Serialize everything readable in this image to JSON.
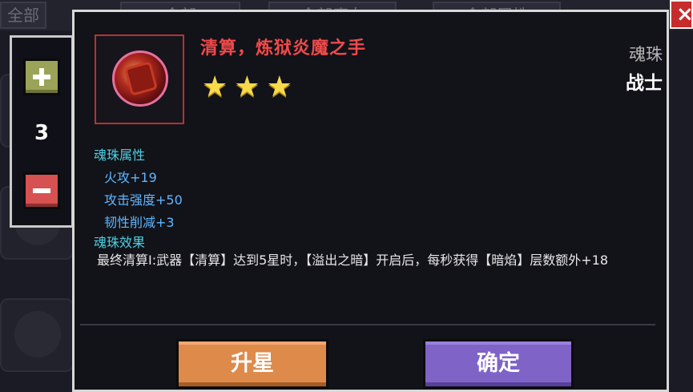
{
  "background": {
    "filters": [
      "全部",
      "全部",
      "全部魔女",
      "全部属性"
    ]
  },
  "counter": {
    "value": "3",
    "plus_icon": "plus-icon",
    "minus_icon": "minus-icon"
  },
  "item": {
    "name": "清算，炼狱炎魔之手",
    "stars": 3,
    "type": "魂珠",
    "class": "战士",
    "icon": "fire-demon-hand-orb-icon"
  },
  "attributes": {
    "heading": "魂珠属性",
    "stats": [
      "火攻+19",
      "攻击强度+50",
      "韧性削减+3"
    ]
  },
  "effect": {
    "heading": "魂珠效果",
    "text": "最终清算Ⅰ:武器【清算】达到5星时，【溢出之暗】开启后，每秒获得【暗焰】层数额外+18"
  },
  "buttons": {
    "upgrade": "升星",
    "confirm": "确定"
  },
  "colors": {
    "name": "#f04a4a",
    "section_heading": "#4fd0e0",
    "stat": "#5fb7ff",
    "upgrade_button": "#de8a4a",
    "confirm_button": "#7f63c7",
    "close_button": "#c72c2c"
  }
}
